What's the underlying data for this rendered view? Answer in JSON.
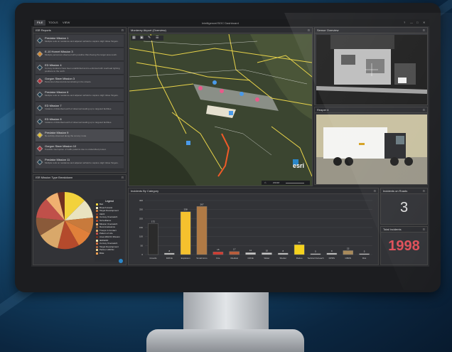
{
  "tabs": [
    "FILE",
    "TOOLS",
    "VIEW"
  ],
  "app_title": "Intelligence/ISOC Dashboard",
  "window_controls": [
    "?",
    "—",
    "□",
    "✕"
  ],
  "reports": {
    "title": "ISR Reports",
    "items": [
      {
        "title": "Predator Mission 1",
        "desc": "Multiple reds on residence and adjacent airfield to capture High Value Targets.",
        "color": "#1c3e4f"
      },
      {
        "title": "E-10 Hornet Mission 3",
        "desc": "Multiple personnel observed with possible rifles fleeing the target area south.",
        "color": "#d98a2b"
      },
      {
        "title": "ED Mission 4",
        "desc": "Convoy locations have been established and re-enforced with overhead lighting positions to the north.",
        "color": "#1c3e4f"
      },
      {
        "title": "Gorgon Stare Mission 3",
        "desc": "Personnel observed demonstrating in the streets.",
        "color": "#b5313a"
      },
      {
        "title": "Predator Mission 6",
        "desc": "Multiple reds on residence and adjacent airfield to capture High Value Targets.",
        "color": "#1c3e4f"
      },
      {
        "title": "ED Mission 7",
        "desc": "Instance of disturbed earth of observed leading up to targeted facilities.",
        "color": "#1c3e4f"
      },
      {
        "title": "ED Mission 8",
        "desc": "Instance of disturbed earth of observed leading up to targeted facilities.",
        "color": "#1c3e4f"
      },
      {
        "title": "Predator Mission 9",
        "desc": "No activity observed along the convoy route.",
        "color": "#e8c22a"
      },
      {
        "title": "Gorgon Stare Mission 10",
        "desc": "Possible interruption of traffic patterns due to unidentified protest.",
        "color": "#b5313a"
      },
      {
        "title": "Predator Mission 11",
        "desc": "Multiple reds on residence and adjacent airfield to capture High Value Targets.",
        "color": "#1c3e4f"
      }
    ]
  },
  "map": {
    "title": "Monterey Airport (Overview)",
    "zoom_label": "ZOOM",
    "logo": "esri"
  },
  "sensor1": {
    "title": "Sensor Overview"
  },
  "sensor2": {
    "title": "Reaper 4"
  },
  "pie": {
    "title": "ISR Mission Type Breakdown",
    "legend_title": "Legend",
    "legend_items": [
      {
        "label": "Bait",
        "color": "#f2d23c"
      },
      {
        "label": "Breach Assist",
        "color": "#e9e3c0"
      },
      {
        "label": "Target Development",
        "color": "#c87a3c"
      },
      {
        "label": "CEOI",
        "color": "#7a3b2a"
      },
      {
        "label": "Convoy Overwatch",
        "color": "#e0803a"
      },
      {
        "label": "Surveillance",
        "color": "#b44a2c"
      },
      {
        "label": "Mission Overwatch",
        "color": "#f0b070"
      },
      {
        "label": "Reconnaissance",
        "color": "#8a5a3a"
      },
      {
        "label": "Troops in Contact",
        "color": "#d9a86a"
      },
      {
        "label": "Pattern of Life",
        "color": "#c0504a"
      },
      {
        "label": "Area ADHOC Mission",
        "color": "#703020"
      },
      {
        "label": "IED/EOD",
        "color": "#f5e8b0"
      },
      {
        "label": "Convoy Overwatch",
        "color": "#d07040"
      },
      {
        "label": "Target Development",
        "color": "#a06040"
      },
      {
        "label": "Partner HDCSc",
        "color": "#e8d090"
      },
      {
        "label": "BGE",
        "color": "#f4a050"
      }
    ]
  },
  "bar": {
    "title": "Incidents By Category",
    "chart_data": {
      "type": "bar",
      "title": "Incidents By Category",
      "ylim": [
        0,
        300
      ],
      "yticks": [
        0,
        50,
        100,
        150,
        200,
        250,
        300
      ],
      "categories": [
        "Crowds",
        "DWCE",
        "Explosion",
        "Small Arms",
        "Fire",
        "Medical",
        "CRCE",
        "Water",
        "Shelter",
        "Rodeo",
        "Tactical Outreach",
        "RPRS",
        "CBRN",
        "Riot"
      ],
      "values": [
        172,
        8,
        238,
        267,
        15,
        17,
        11,
        10,
        8,
        55,
        5,
        8,
        22,
        5
      ],
      "colors": [
        "#2b2b2b",
        "#c9c9c9",
        "#f5c12e",
        "#b07a45",
        "#d03a30",
        "#b85c3a",
        "#c9c9c9",
        "#c9c9c9",
        "#c9c9c9",
        "#f5d21e",
        "#c9c9c9",
        "#c9c9c9",
        "#a88a5a",
        "#c9c9c9"
      ],
      "labels": [
        "172",
        "8",
        "238",
        "267",
        "15",
        "17",
        "11",
        "10",
        "8",
        "55",
        "5",
        "8",
        "22",
        "5"
      ]
    }
  },
  "roads": {
    "title": "Incidents on Roads",
    "value": "3"
  },
  "total": {
    "title": "Total Incidents",
    "value": "1998"
  }
}
